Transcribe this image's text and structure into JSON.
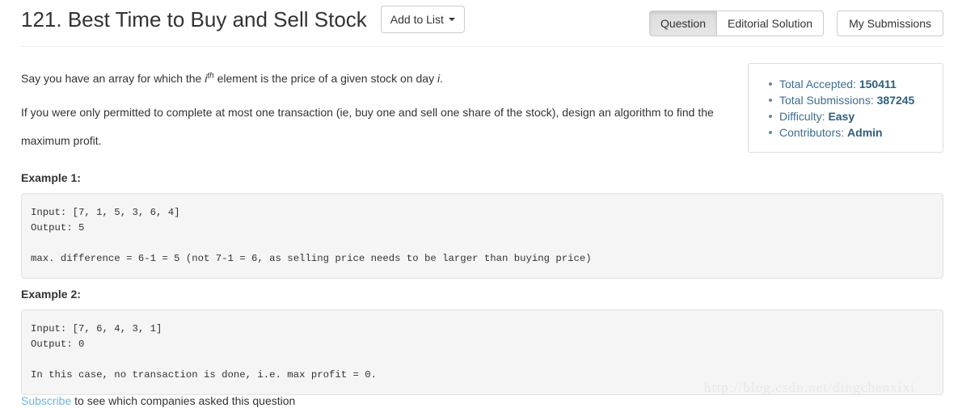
{
  "header": {
    "problem_title": "121. Best Time to Buy and Sell Stock",
    "add_to_list_label": "Add to List",
    "tabs": [
      {
        "label": "Question",
        "active": true
      },
      {
        "label": "Editorial Solution",
        "active": false
      }
    ],
    "my_submissions_label": "My Submissions"
  },
  "question": {
    "paragraph1": {
      "before": "Say you have an array for which the ",
      "italic_i": "i",
      "superscript": "th",
      "after": " element is the price of a given stock on day ",
      "trailing_italic": "i",
      "period": "."
    },
    "paragraph2": "If you were only permitted to complete at most one transaction (ie, buy one and sell one share of the stock), design an algorithm to find the maximum profit."
  },
  "examples": [
    {
      "label": "Example 1:",
      "code": "Input: [7, 1, 5, 3, 6, 4]\nOutput: 5\n\nmax. difference = 6-1 = 5 (not 7-1 = 6, as selling price needs to be larger than buying price)"
    },
    {
      "label": "Example 2:",
      "code": "Input: [7, 6, 4, 3, 1]\nOutput: 0\n\nIn this case, no transaction is done, i.e. max profit = 0."
    }
  ],
  "stats": {
    "items": [
      {
        "label": "Total Accepted:",
        "value": "150411"
      },
      {
        "label": "Total Submissions:",
        "value": "387245"
      },
      {
        "label": "Difficulty:",
        "value": "Easy"
      },
      {
        "label": "Contributors:",
        "value": "Admin"
      }
    ]
  },
  "subscribe": {
    "link_text": "Subscribe",
    "rest_text": " to see which companies asked this question"
  },
  "watermark": "http://blog.csdn.net/dingchenxixi",
  "colors": {
    "accent_link": "#6bb6dd",
    "stats_text": "#3c6e8f",
    "code_bg": "#f5f5f5",
    "border": "#cccccc"
  }
}
